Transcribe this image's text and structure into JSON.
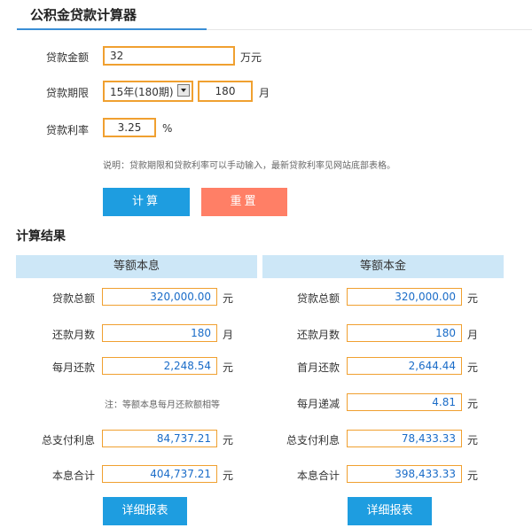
{
  "page": {
    "title": "公积金贷款计算器"
  },
  "form": {
    "amount_label": "贷款金额",
    "amount_value": "32",
    "amount_unit": "万元",
    "term_label": "贷款期限",
    "term_select": "15年(180期)",
    "term_months": "180",
    "term_unit": "月",
    "rate_label": "贷款利率",
    "rate_value": "3.25",
    "rate_unit": "%",
    "note": "说明：贷款期限和贷款利率可以手动输入，最新贷款利率见网站底部表格。",
    "calc_label": "计算",
    "reset_label": "重置"
  },
  "results": {
    "title": "计算结果",
    "equal_payment": {
      "header": "等额本息",
      "rows": [
        {
          "label": "贷款总额",
          "value": "320,000.00",
          "unit": "元"
        },
        {
          "label": "还款月数",
          "value": "180",
          "unit": "月"
        },
        {
          "label": "每月还款",
          "value": "2,248.54",
          "unit": "元"
        }
      ],
      "note": "注：等额本息每月还款额相等",
      "rows2": [
        {
          "label": "总支付利息",
          "value": "84,737.21",
          "unit": "元"
        },
        {
          "label": "本息合计",
          "value": "404,737.21",
          "unit": "元"
        }
      ],
      "detail_label": "详细报表"
    },
    "equal_principal": {
      "header": "等额本金",
      "rows": [
        {
          "label": "贷款总额",
          "value": "320,000.00",
          "unit": "元"
        },
        {
          "label": "还款月数",
          "value": "180",
          "unit": "月"
        },
        {
          "label": "首月还款",
          "value": "2,644.44",
          "unit": "元"
        },
        {
          "label": "每月递减",
          "value": "4.81",
          "unit": "元"
        },
        {
          "label": "总支付利息",
          "value": "78,433.33",
          "unit": "元"
        },
        {
          "label": "本息合计",
          "value": "398,433.33",
          "unit": "元"
        }
      ],
      "detail_label": "详细报表"
    }
  }
}
